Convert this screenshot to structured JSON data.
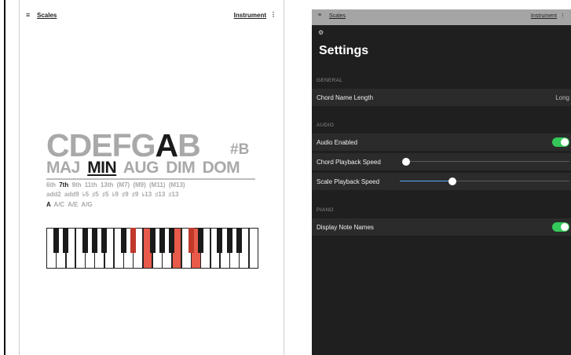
{
  "light": {
    "topbar": {
      "menu_icon": "≡",
      "scales": "Scales",
      "instrument": "Instrument",
      "more_icon": "⋮"
    },
    "notes": [
      "C",
      "D",
      "E",
      "F",
      "G",
      "A",
      "B"
    ],
    "highlighted_notes": [
      "A"
    ],
    "sharp": "#B",
    "qualities": [
      "MAJ",
      "MIN",
      "AUG",
      "DIM",
      "DOM"
    ],
    "selected_quality": "MIN",
    "extensions_row1": [
      "6th",
      "7th",
      "9th",
      "11th",
      "13th",
      "(M7)",
      "(M9)",
      "(M11)",
      "(M13)"
    ],
    "selected_extension": "7th",
    "extensions_row2": [
      "add2",
      "add9",
      "♭5",
      "♯5",
      "♯5",
      "♭9",
      "♯9",
      "♯9",
      "♭13",
      "♯13",
      "♯13"
    ],
    "slash_row": [
      "A",
      "A/C",
      "A/E",
      "A/G"
    ],
    "selected_slash": "A",
    "piano": {
      "white_count": 22,
      "highlighted_white": [
        10,
        13,
        15
      ],
      "highlighted_black": [
        6,
        10
      ]
    }
  },
  "dark": {
    "topbar": {
      "menu_icon": "≡",
      "scales": "Scales",
      "instrument": "Instrument",
      "more_icon": "⋮"
    },
    "gear_icon": "⚙",
    "title": "Settings",
    "general_header": "GENERAL",
    "chord_name_length": {
      "label": "Chord Name Length",
      "value": "Long"
    },
    "audio_header": "AUDIO",
    "audio_enabled": {
      "label": "Audio Enabled",
      "on": true
    },
    "chord_playback_speed": {
      "label": "Chord Playback Speed",
      "value": 0.0
    },
    "scale_playback_speed": {
      "label": "Scale Playback Speed",
      "value": 0.32
    },
    "piano_header": "PIANO",
    "display_note_names": {
      "label": "Display Note Names",
      "on": true
    },
    "accent": "#34c759"
  }
}
